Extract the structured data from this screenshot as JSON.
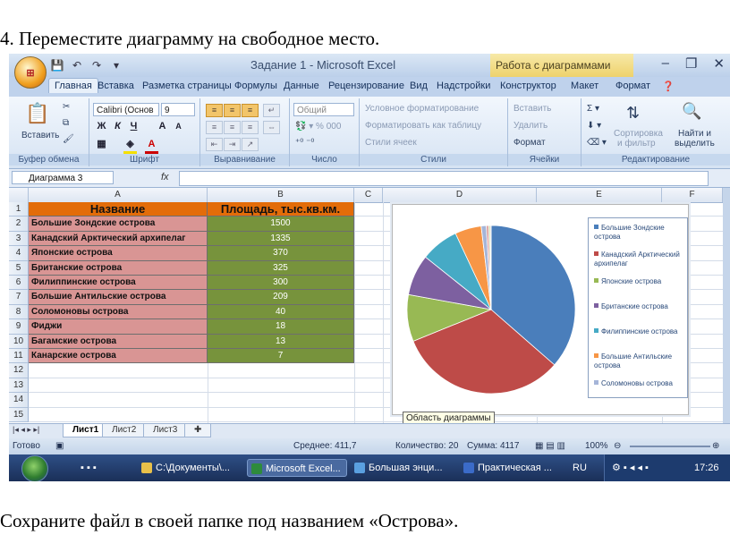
{
  "doc": {
    "instruction_top": "4. Переместите диаграмму на свободное место.",
    "instruction_bottom": "Сохраните файл в своей папке под названием «Острова»."
  },
  "window": {
    "title": "Задание 1 - Microsoft Excel",
    "context_tab": "Работа с диаграммами",
    "office_button": "⊞"
  },
  "tabs": [
    "Главная",
    "Вставка",
    "Разметка страницы",
    "Формулы",
    "Данные",
    "Рецензирование",
    "Вид",
    "Надстройки",
    "Конструктор",
    "Макет",
    "Формат"
  ],
  "ribbon": {
    "clipboard": {
      "paste": "Вставить",
      "label": "Буфер обмена"
    },
    "font": {
      "name": "Calibri (Основ",
      "size": "9",
      "label": "Шрифт"
    },
    "alignment": {
      "label": "Выравнивание"
    },
    "number": {
      "format": "Общий",
      "label": "Число"
    },
    "styles": {
      "conditional": "Условное форматирование",
      "as_table": "Форматировать как таблицу",
      "cell_styles": "Стили ячеек",
      "label": "Стили"
    },
    "cells": {
      "insert": "Вставить",
      "delete": "Удалить",
      "format": "Формат",
      "label": "Ячейки"
    },
    "editing": {
      "sort": "Сортировка",
      "sort2": "и фильтр",
      "find": "Найти и",
      "find2": "выделить",
      "label": "Редактирование"
    }
  },
  "formula_bar": {
    "name_box": "Диаграмма 3",
    "fx": "fx",
    "value": ""
  },
  "columns": [
    "A",
    "B",
    "C",
    "D",
    "E",
    "F"
  ],
  "rows": [
    "1",
    "2",
    "3",
    "4",
    "5",
    "6",
    "7",
    "8",
    "9",
    "10",
    "11",
    "12",
    "13",
    "14",
    "15"
  ],
  "table": {
    "headers": [
      "Название",
      "Площадь, тыс.кв.км."
    ],
    "rows": [
      [
        "Большие Зондские острова",
        "1500"
      ],
      [
        "Канадский Арктический архипелаг",
        "1335"
      ],
      [
        "Японские острова",
        "370"
      ],
      [
        "Британские острова",
        "325"
      ],
      [
        "Филиппинские острова",
        "300"
      ],
      [
        "Большие Антильские острова",
        "209"
      ],
      [
        "Соломоновы острова",
        "40"
      ],
      [
        "Фиджи",
        "18"
      ],
      [
        "Багамские острова",
        "13"
      ],
      [
        "Канарские острова",
        "7"
      ]
    ]
  },
  "chart_data": {
    "type": "pie",
    "categories": [
      "Большие Зондские острова",
      "Канадский Арктический архипелаг",
      "Японские острова",
      "Британские острова",
      "Филиппинские острова",
      "Большие Антильские острова",
      "Соломоновы острова",
      "Фиджи",
      "Багамские острова",
      "Канарские острова"
    ],
    "values": [
      1500,
      1335,
      370,
      325,
      300,
      209,
      40,
      18,
      13,
      7
    ],
    "legend_entries": [
      "Большие Зондские острова",
      "Канадский Арктический архипелаг",
      "Японские острова",
      "Британские острова",
      "Филиппинские острова",
      "Большие Антильские острова",
      "Соломоновы острова"
    ],
    "colors": [
      "#4a7ebb",
      "#be4b48",
      "#98b954",
      "#7d60a0",
      "#46aac5",
      "#f79646",
      "#a5b5d8",
      "#d89694",
      "#c0d394",
      "#b3a2c7"
    ],
    "legend_position": "right"
  },
  "chart_tooltip": "Область диаграммы",
  "sheets": [
    "Лист1",
    "Лист2",
    "Лист3"
  ],
  "status": {
    "ready": "Готово",
    "average": "Среднее: 411,7",
    "count": "Количество: 20",
    "sum": "Сумма: 4117",
    "zoom": "100%"
  },
  "taskbar": {
    "items": [
      "C:\\Документы\\...",
      "Microsoft Excel...",
      "Большая энци...",
      "Практическая ..."
    ],
    "lang": "RU",
    "time": "17:26"
  }
}
